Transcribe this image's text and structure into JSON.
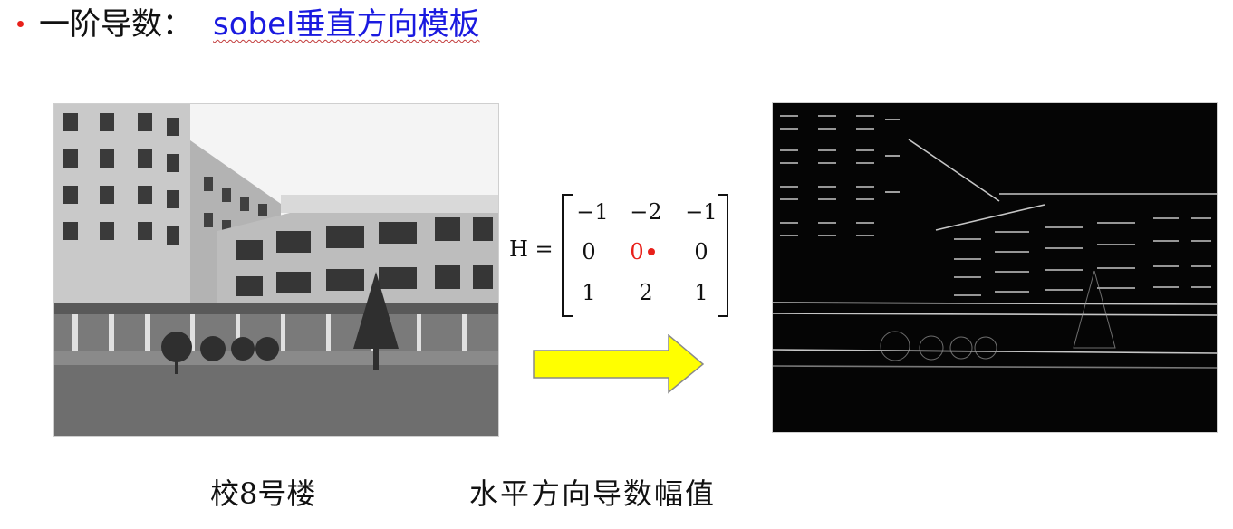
{
  "heading": {
    "text": "一阶导数：",
    "link_text": "sobel垂直方向模板"
  },
  "matrix": {
    "label": "H =",
    "rows": [
      [
        "−1",
        "−2",
        "−1"
      ],
      [
        "0",
        "0",
        "0"
      ],
      [
        "1",
        "2",
        "1"
      ]
    ],
    "highlight_color": "#e8201a"
  },
  "arrow": {
    "fill": "#ffff00",
    "stroke": "#8a8a8a"
  },
  "captions": {
    "left": "校8号楼",
    "right": "水平方向导数幅值"
  },
  "colors": {
    "heading_link": "#1a1ae0",
    "bullet": "#e8201a"
  }
}
